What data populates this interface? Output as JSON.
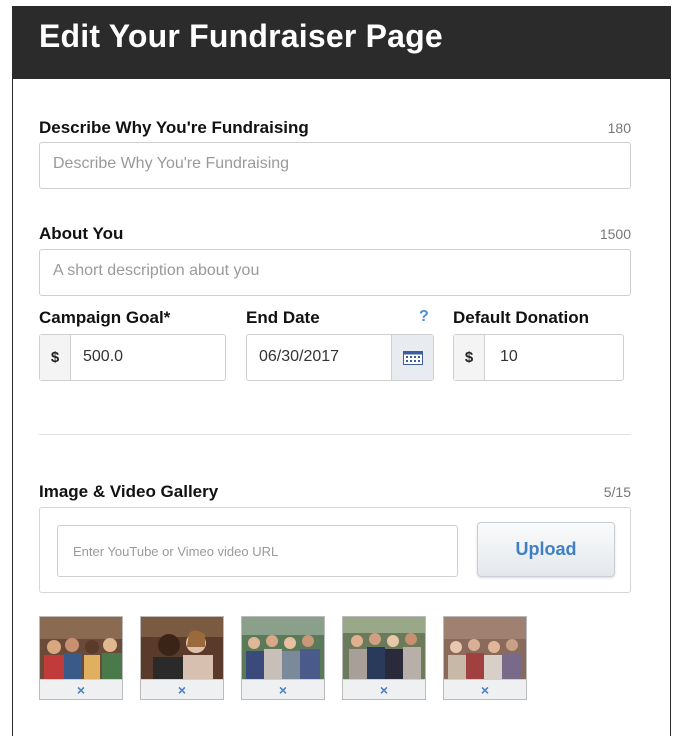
{
  "header": {
    "title": "Edit Your Fundraiser Page"
  },
  "why": {
    "label": "Describe Why You're Fundraising",
    "limit": "180",
    "placeholder": "Describe Why You're Fundraising"
  },
  "about": {
    "label": "About You",
    "limit": "1500",
    "placeholder": "A short description about you"
  },
  "goal": {
    "label": "Campaign Goal*",
    "currency": "$",
    "value": "500.0"
  },
  "end_date": {
    "label": "End Date",
    "help": "?",
    "value": "06/30/2017",
    "icon": "calendar-icon"
  },
  "donation": {
    "label": "Default Donation",
    "currency": "$",
    "value": "10"
  },
  "gallery": {
    "label": "Image & Video Gallery",
    "count": "5/15",
    "url_placeholder": "Enter YouTube or Vimeo video URL",
    "upload_label": "Upload",
    "thumbnails": [
      {
        "remove": "×",
        "colors": [
          "#6b4a3a",
          "#c23b3b",
          "#3a5a8a",
          "#e0b060"
        ]
      },
      {
        "remove": "×",
        "colors": [
          "#5a3a2a",
          "#2a2a2a",
          "#8a7060",
          "#d8c0b0"
        ]
      },
      {
        "remove": "×",
        "colors": [
          "#4a6a4a",
          "#3a4a7a",
          "#c8c0b8",
          "#7a8a9a"
        ]
      },
      {
        "remove": "×",
        "colors": [
          "#5a6a4a",
          "#2a3a5a",
          "#a8a098",
          "#6a7a5a"
        ]
      },
      {
        "remove": "×",
        "colors": [
          "#8a6a5a",
          "#c8b8a8",
          "#a04040",
          "#d8d0c8"
        ]
      }
    ]
  },
  "colors": {
    "header_bg": "#2b2b2b",
    "accent": "#3f7fc4"
  }
}
